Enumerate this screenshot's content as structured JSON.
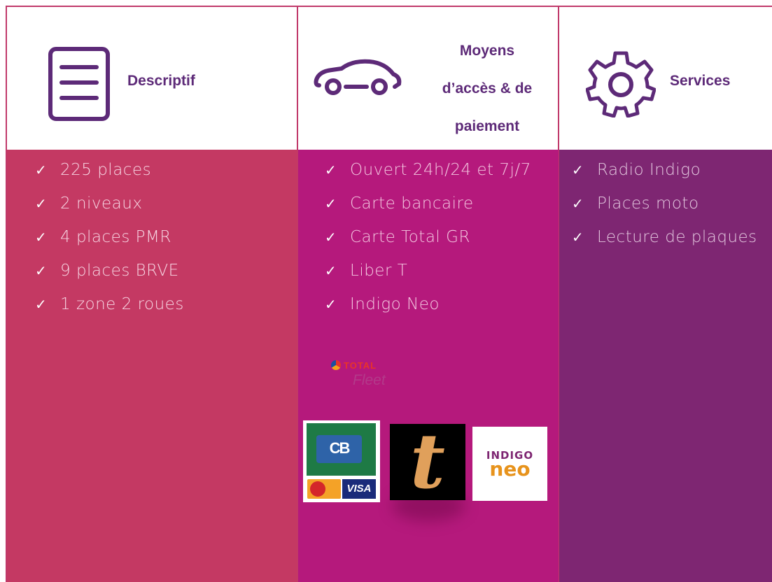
{
  "colors": {
    "border": "#c0396a",
    "header_text": "#5d2a78",
    "col1_bg": "#c43963",
    "col2_bg": "#b5197c",
    "col3_bg": "#7e2672"
  },
  "columns": [
    {
      "title": "Descriptif",
      "icon": "document-lines-icon",
      "items": [
        "225 places",
        "2 niveaux",
        "4 places PMR",
        "9 places BRVE",
        "1 zone 2 roues"
      ]
    },
    {
      "title_lines": [
        "Moyens",
        "d’accès & de",
        "paiement"
      ],
      "icon": "car-icon",
      "items": [
        "Ouvert 24h/24 et 7j/7",
        "Carte bancaire",
        "Carte Total GR",
        "Liber T",
        "Indigo Neo"
      ]
    },
    {
      "title": "Services",
      "icon": "gear-icon",
      "items": [
        "Radio Indigo",
        "Places moto",
        "Lecture de plaques"
      ]
    }
  ],
  "check_glyph": "✓",
  "logos": {
    "total": {
      "line1": "TOTAL",
      "line2": "Fleet"
    },
    "cb": {
      "main": "CB",
      "visa": "VISA"
    },
    "tl": {
      "glyph": "t"
    },
    "neo": {
      "line1": "INDIGO",
      "line2": "neo"
    }
  }
}
